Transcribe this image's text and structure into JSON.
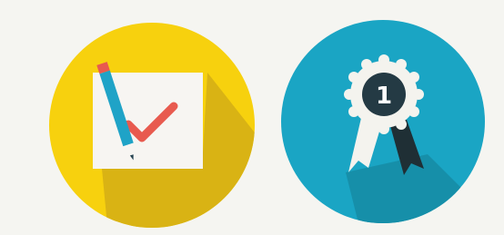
{
  "icons": [
    {
      "name": "checklist-icon",
      "colors": {
        "circle": "#f7d10e",
        "circle_shadow": "#d9b314",
        "card": "#f7f5f2",
        "check": "#e85a4f",
        "pencil_body": "#1fa3c7",
        "pencil_tip": "#e85a4f",
        "pencil_lead": "#274452"
      }
    },
    {
      "name": "award-ribbon-icon",
      "badge_number": "1",
      "colors": {
        "circle": "#1aa5c4",
        "circle_shadow": "#168fa9",
        "rosette": "#f4f3ee",
        "medal_center": "#243a44",
        "ribbon_dark": "#1f2f35"
      }
    }
  ]
}
